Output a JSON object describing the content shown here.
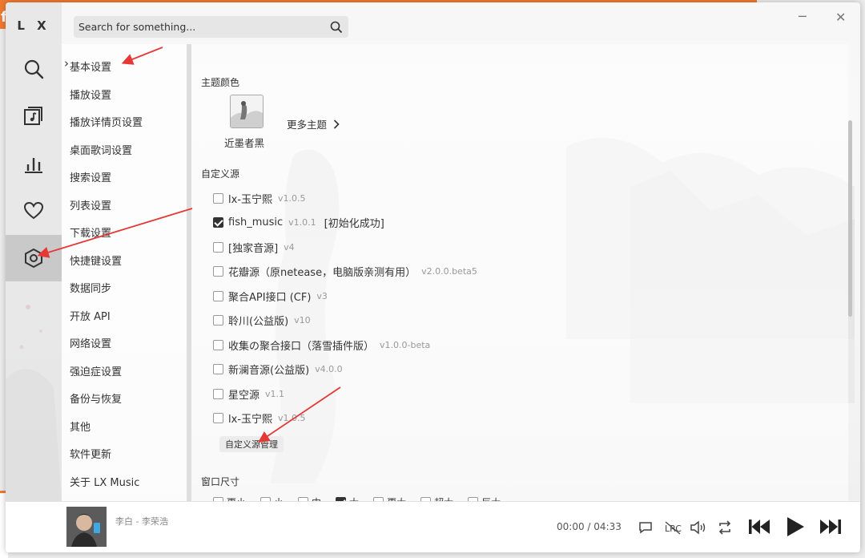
{
  "app": {
    "logo": "L X"
  },
  "search": {
    "placeholder": "Search for something..."
  },
  "settings_nav": [
    "基本设置",
    "播放设置",
    "播放详情页设置",
    "桌面歌词设置",
    "搜索设置",
    "列表设置",
    "下载设置",
    "快捷键设置",
    "数据同步",
    "开放 API",
    "网络设置",
    "强迫症设置",
    "备份与恢复",
    "其他",
    "软件更新",
    "关于 LX Music"
  ],
  "theme": {
    "section": "主题颜色",
    "current": "近墨者黑",
    "more": "更多主题"
  },
  "custom_source": {
    "section": "自定义源",
    "items": [
      {
        "name": "lx-玉宁熙",
        "version": "v1.0.5",
        "checked": false,
        "status": ""
      },
      {
        "name": "fish_music",
        "version": "v1.0.1",
        "checked": true,
        "status": "[初始化成功]"
      },
      {
        "name": "[独家音源]",
        "version": "v4",
        "checked": false,
        "status": ""
      },
      {
        "name": "花瓣源（原netease，电脑版亲测有用）",
        "version": "v2.0.0.beta5",
        "checked": false,
        "status": ""
      },
      {
        "name": "聚合API接口 (CF)",
        "version": "v3",
        "checked": false,
        "status": ""
      },
      {
        "name": "聆川(公益版)",
        "version": "v10",
        "checked": false,
        "status": ""
      },
      {
        "name": "收集の聚合接口（落雪插件版）",
        "version": "v1.0.0-beta",
        "checked": false,
        "status": ""
      },
      {
        "name": "新澜音源(公益版)",
        "version": "v4.0.0",
        "checked": false,
        "status": ""
      },
      {
        "name": "星空源",
        "version": "v1.1",
        "checked": false,
        "status": ""
      },
      {
        "name": "lx-玉宁熙",
        "version": "v1.0.5",
        "checked": false,
        "status": ""
      }
    ],
    "manage_button": "自定义源管理"
  },
  "window_size": {
    "section": "窗口尺寸",
    "options": [
      {
        "label": "更小",
        "checked": false
      },
      {
        "label": "小",
        "checked": false
      },
      {
        "label": "中",
        "checked": false
      },
      {
        "label": "大",
        "checked": true
      },
      {
        "label": "更大",
        "checked": false
      },
      {
        "label": "超大",
        "checked": false
      },
      {
        "label": "巨大",
        "checked": false
      }
    ]
  },
  "player": {
    "song": "李白 - 李荣浩",
    "current_time": "00:00",
    "separator": "/",
    "duration": "04:33"
  },
  "colors": {
    "accent": "#f0792f",
    "arrow": "#e53935",
    "text": "#333333"
  }
}
